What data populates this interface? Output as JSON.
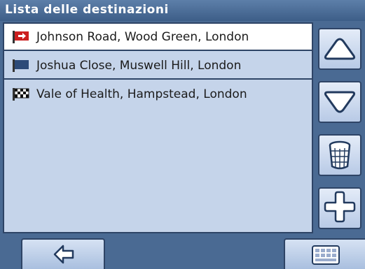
{
  "header": {
    "title": "Lista delle destinazioni"
  },
  "destinations": [
    {
      "label": "Johnson Road, Wood Green, London",
      "icon": "red-arrow-flag-icon"
    },
    {
      "label": "Joshua Close, Muswell Hill, London",
      "icon": "blue-flag-icon"
    },
    {
      "label": "Vale of Health, Hampstead, London",
      "icon": "checkered-flag-icon"
    }
  ],
  "side_buttons": [
    "scroll-up-icon",
    "scroll-down-icon",
    "trash-icon",
    "add-icon"
  ],
  "bottom_buttons": [
    "back-arrow-icon",
    "keyboard-icon"
  ],
  "colors": {
    "background": "#4a6a93",
    "list": "#c5d4ea",
    "selected_row": "#ffffff",
    "border": "#2e4466"
  }
}
